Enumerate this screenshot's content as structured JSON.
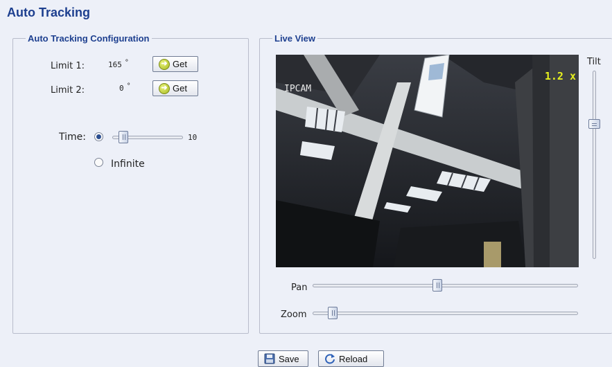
{
  "page": {
    "title": "Auto Tracking"
  },
  "config": {
    "legend": "Auto Tracking Configuration",
    "limit1": {
      "label": "Limit 1:",
      "value": "165",
      "unit": "°",
      "button": "Get"
    },
    "limit2": {
      "label": "Limit 2:",
      "value": "0",
      "unit": "°",
      "button": "Get"
    },
    "time": {
      "label": "Time:",
      "value": "10",
      "selected": true,
      "slider_fraction": 0.1
    },
    "infinite": {
      "label": "Infinite",
      "selected": false
    }
  },
  "live": {
    "legend": "Live View",
    "camera_name": "IPCAM",
    "zoom_text": "1.2 x",
    "tilt_label": "Tilt",
    "pan_label": "Pan",
    "zoom_label": "Zoom",
    "tilt_fraction": 0.27,
    "pan_fraction": 0.47,
    "zoom_fraction": 0.06
  },
  "actions": {
    "save": "Save",
    "reload": "Reload"
  },
  "colors": {
    "title": "#1d3f8f",
    "zoom_overlay": "#e6f01e",
    "background": "#edf0f8"
  }
}
